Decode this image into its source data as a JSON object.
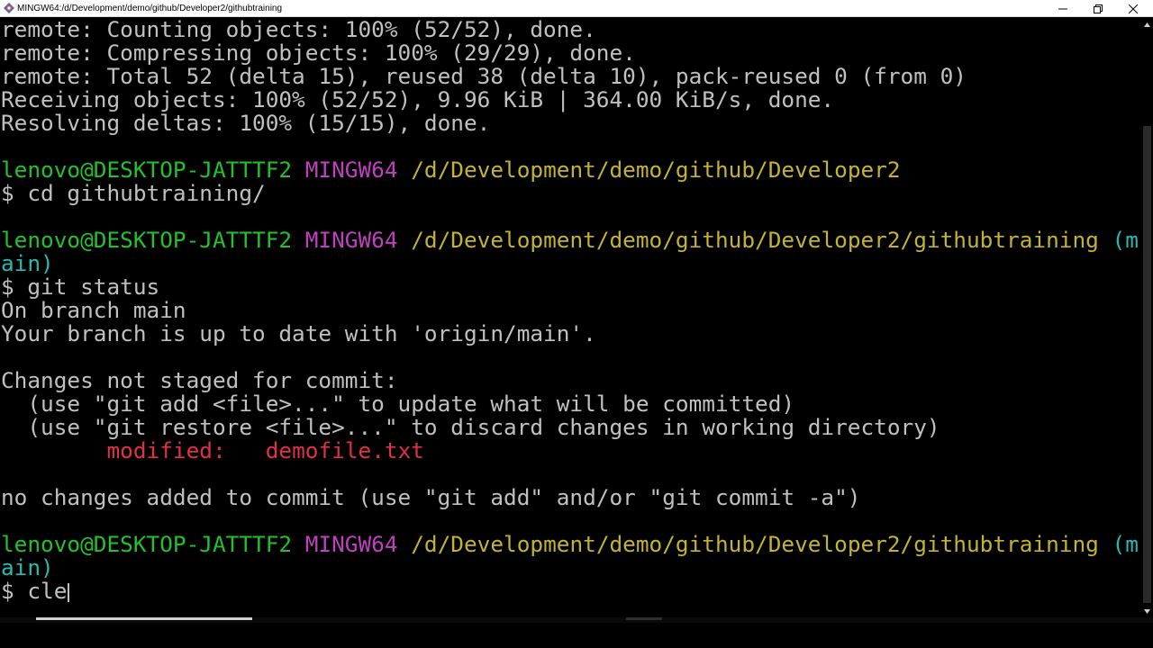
{
  "window": {
    "title": "MINGW64:/d/Development/demo/github/Developer2/githubtraining",
    "icon": "git-bash-app-icon",
    "controls": [
      "minimize-icon",
      "maximize-icon",
      "close-icon"
    ]
  },
  "colors": {
    "background": "#000000",
    "text": "#c0c0c0",
    "user_host": "#23c12d",
    "mingw": "#bf40bf",
    "path": "#c3b32f",
    "branch": "#2bb8b0",
    "modified": "#e0304a"
  },
  "terminal": {
    "clone_output": [
      "remote: Counting objects: 100% (52/52), done.",
      "remote: Compressing objects: 100% (29/29), done.",
      "remote: Total 52 (delta 15), reused 38 (delta 10), pack-reused 0 (from 0)",
      "Receiving objects: 100% (52/52), 9.96 KiB | 364.00 KiB/s, done.",
      "Resolving deltas: 100% (15/15), done."
    ],
    "prompt1": {
      "user_host": "lenovo@DESKTOP-JATTTF2",
      "env": "MINGW64",
      "path": "/d/Development/demo/github/Developer2"
    },
    "command1": "$ cd githubtraining/",
    "prompt2": {
      "user_host": "lenovo@DESKTOP-JATTTF2",
      "env": "MINGW64",
      "path": "/d/Development/demo/github/Developer2/githubtraining",
      "branch_part1": "(m",
      "branch_part2": "ain)"
    },
    "command2": "$ git status",
    "status": {
      "branch_line": "On branch main",
      "uptodate_line": "Your branch is up to date with 'origin/main'.",
      "changes_header": "Changes not staged for commit:",
      "hint_add": "  (use \"git add <file>...\" to update what will be committed)",
      "hint_restore": "  (use \"git restore <file>...\" to discard changes in working directory)",
      "modified_label": "modified:",
      "modified_file": "demofile.txt",
      "summary": "no changes added to commit (use \"git add\" and/or \"git commit -a\")"
    },
    "prompt3": {
      "user_host": "lenovo@DESKTOP-JATTTF2",
      "env": "MINGW64",
      "path": "/d/Development/demo/github/Developer2/githubtraining",
      "branch_part1": "(m",
      "branch_part2": "ain)"
    },
    "current_input": "$ cle"
  }
}
